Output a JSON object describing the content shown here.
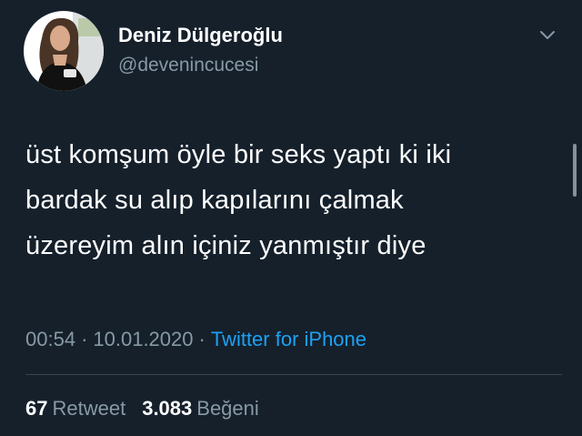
{
  "user": {
    "display_name": "Deniz Dülgeroğlu",
    "handle": "@devenincucesi"
  },
  "tweet": {
    "lines": [
      "üst komşum öyle bir seks yaptı ki iki",
      "bardak su alıp kapılarını çalmak",
      "üzereyim alın içiniz yanmıştır diye"
    ],
    "time": "00:54",
    "separator": "·",
    "date": "10.01.2020",
    "source": "Twitter for iPhone"
  },
  "stats": {
    "retweet_count": "67",
    "retweet_label": "Retweet",
    "like_count": "3.083",
    "like_label": "Beğeni"
  },
  "icons": {
    "menu": "chevron-down-icon"
  },
  "colors": {
    "background": "#15202b",
    "primary_text": "#ffffff",
    "secondary_text": "#8899a6",
    "link": "#1da1f2",
    "divider": "#38444d"
  }
}
